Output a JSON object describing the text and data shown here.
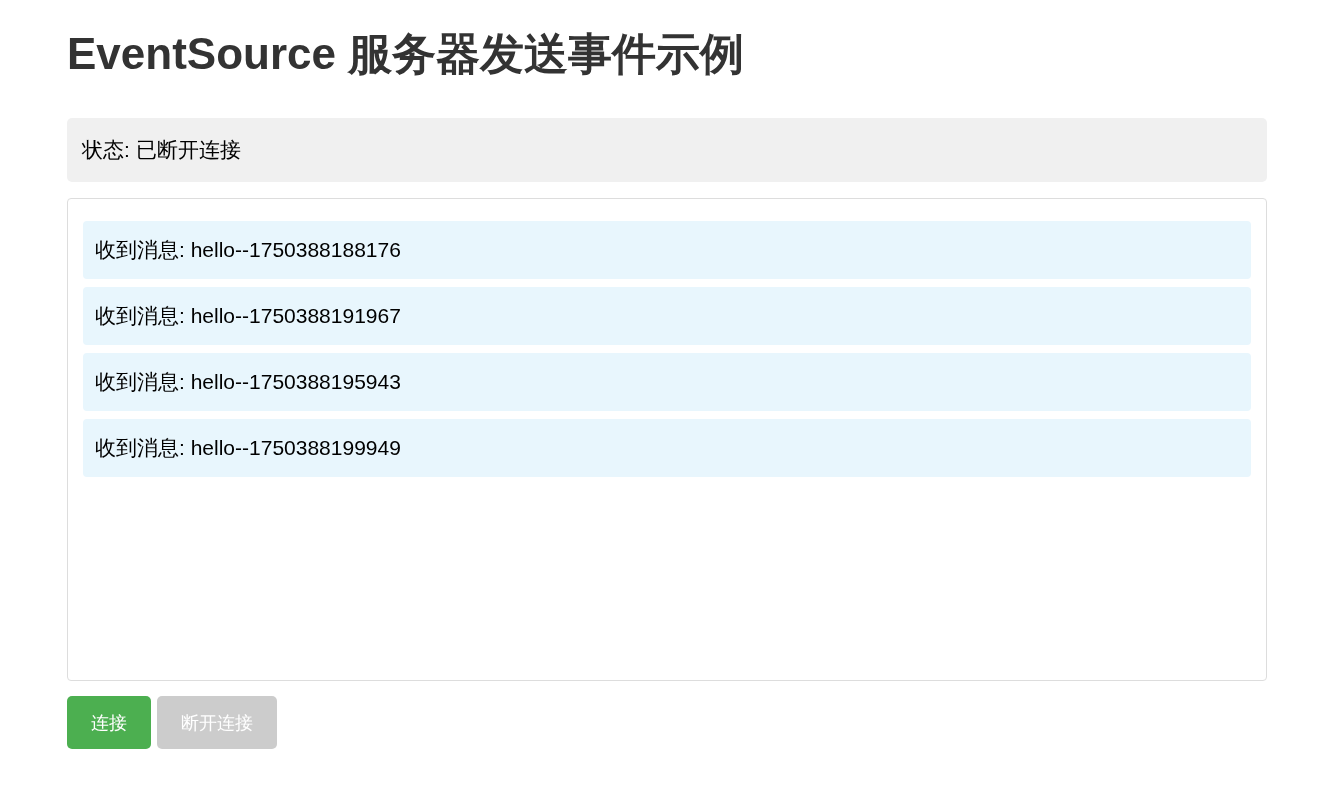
{
  "title": "EventSource 服务器发送事件示例",
  "status": "状态: 已断开连接",
  "messages": [
    {
      "text": "收到消息: hello--1750388188176"
    },
    {
      "text": "收到消息: hello--1750388191967"
    },
    {
      "text": "收到消息: hello--1750388195943"
    },
    {
      "text": "收到消息: hello--1750388199949"
    }
  ],
  "buttons": [
    {
      "label": "连接",
      "disabled": false
    },
    {
      "label": "断开连接",
      "disabled": true
    }
  ]
}
